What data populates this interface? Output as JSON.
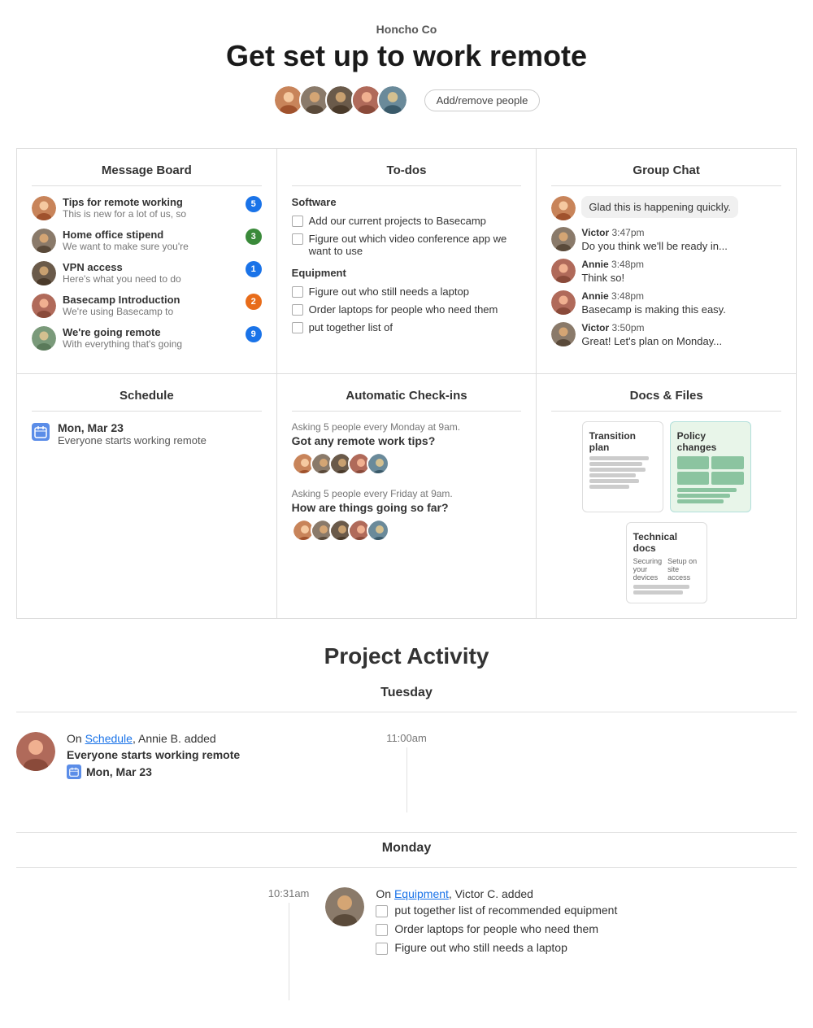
{
  "header": {
    "subtitle": "Honcho Co",
    "title": "Get set up to work remote",
    "add_people_label": "Add/remove people"
  },
  "message_board": {
    "panel_title": "Message Board",
    "messages": [
      {
        "id": 1,
        "title": "Tips for remote working",
        "preview": "This is new for a lot of us, so",
        "badge": "5",
        "badge_type": "blue",
        "avatar_color": "#c8845a"
      },
      {
        "id": 2,
        "title": "Home office stipend",
        "preview": "We want to make sure you're",
        "badge": "3",
        "badge_type": "green",
        "avatar_color": "#8a7a6a"
      },
      {
        "id": 3,
        "title": "VPN access",
        "preview": "Here's what you need to do",
        "badge": "1",
        "badge_type": "blue",
        "avatar_color": "#6a5a4a"
      },
      {
        "id": 4,
        "title": "Basecamp Introduction",
        "preview": "We're using Basecamp to",
        "badge": "2",
        "badge_type": "orange",
        "avatar_color": "#b06a5a"
      },
      {
        "id": 5,
        "title": "We're going remote",
        "preview": "With everything that's going",
        "badge": "9",
        "badge_type": "blue",
        "avatar_color": "#7a9a7a"
      }
    ]
  },
  "todos": {
    "panel_title": "To-dos",
    "sections": [
      {
        "title": "Software",
        "items": [
          "Add our current projects to Basecamp",
          "Figure out which video conference app we want to use"
        ]
      },
      {
        "title": "Equipment",
        "items": [
          "Figure out who still needs a laptop",
          "Order laptops for people who need them",
          "put together list of"
        ]
      }
    ]
  },
  "group_chat": {
    "panel_title": "Group Chat",
    "messages": [
      {
        "id": 1,
        "type": "bubble_only",
        "text": "Glad this is happening quickly.",
        "avatar_color": "#c8845a"
      },
      {
        "id": 2,
        "type": "with_avatar",
        "name": "Victor",
        "time": "3:47pm",
        "text": "Do you think we'll be ready in...",
        "avatar_color": "#8a7a6a"
      },
      {
        "id": 3,
        "type": "with_avatar",
        "name": "Annie",
        "time": "3:48pm",
        "text": "Think so!",
        "avatar_color": "#b06a5a"
      },
      {
        "id": 4,
        "type": "with_avatar",
        "name": "Annie",
        "time": "3:48pm",
        "text": "Basecamp is making this easy.",
        "avatar_color": "#b06a5a"
      },
      {
        "id": 5,
        "type": "with_avatar",
        "name": "Victor",
        "time": "3:50pm",
        "text": "Great! Let's plan on Monday...",
        "avatar_color": "#8a7a6a"
      }
    ]
  },
  "schedule": {
    "panel_title": "Schedule",
    "events": [
      {
        "date": "Mon, Mar 23",
        "description": "Everyone starts working remote"
      }
    ]
  },
  "checkins": {
    "panel_title": "Automatic Check-ins",
    "items": [
      {
        "freq": "Asking 5 people every Monday at 9am.",
        "question": "Got any remote work tips?"
      },
      {
        "freq": "Asking 5 people every Friday at 9am.",
        "question": "How are things going so far?"
      }
    ]
  },
  "docs": {
    "panel_title": "Docs & Files",
    "files": [
      {
        "id": 1,
        "title": "Transition plan",
        "type": "white"
      },
      {
        "id": 2,
        "title": "Policy changes",
        "type": "green"
      },
      {
        "id": 3,
        "title": "Technical docs",
        "type": "white"
      }
    ]
  },
  "activity": {
    "section_title": "Project Activity",
    "days": [
      {
        "day_label": "Tuesday",
        "entries": [
          {
            "time": "11:00am",
            "avatar_color": "#b06a5a",
            "action_prefix": "On",
            "action_link": "Schedule",
            "action_suffix": ", Annie B. added",
            "bold_text": "Everyone starts working remote",
            "event_label": "Mon, Mar 23",
            "type": "schedule"
          }
        ]
      },
      {
        "day_label": "Monday",
        "entries": [
          {
            "time": "10:31am",
            "avatar_color": "#8a7a6a",
            "action_prefix": "On",
            "action_link": "Equipment",
            "action_suffix": ", Victor C. added",
            "type": "todos",
            "todo_items": [
              "put together list of recommended equipment",
              "Order laptops for people who need them",
              "Figure out who still needs a laptop"
            ]
          }
        ]
      }
    ]
  }
}
